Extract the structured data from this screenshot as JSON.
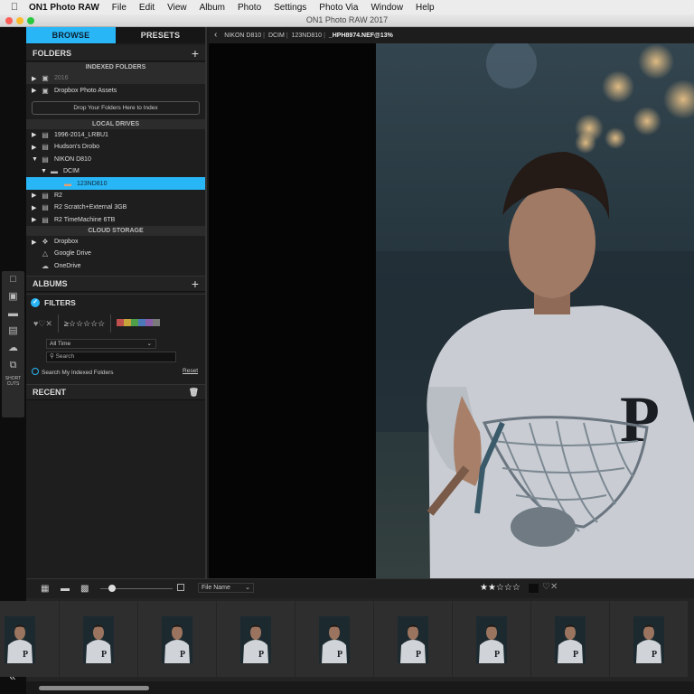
{
  "menubar": {
    "app": "ON1 Photo RAW",
    "items": [
      "File",
      "Edit",
      "View",
      "Album",
      "Photo",
      "Settings",
      "Photo Via",
      "Window",
      "Help"
    ]
  },
  "window": {
    "title": "ON1 Photo RAW 2017"
  },
  "colors": {
    "accent": "#29b6f6",
    "close": "#fc5f57",
    "minimize": "#fdbc2e",
    "zoom": "#29c840"
  },
  "tabs": {
    "browse": "BROWSE",
    "presets": "PRESETS"
  },
  "folders": {
    "title": "FOLDERS",
    "indexed_header": "INDEXED FOLDERS",
    "indexed": [
      {
        "label": "2016"
      },
      {
        "label": "Dropbox Photo Assets"
      }
    ],
    "drop_label": "Drop Your Folders Here to Index",
    "local_header": "LOCAL DRIVES",
    "local": [
      {
        "label": "1996-2014_LRBU1"
      },
      {
        "label": "Hudson's Drobo"
      },
      {
        "label": "NIKON D810"
      },
      {
        "label": "DCIM"
      },
      {
        "label": "123ND810"
      },
      {
        "label": "R2"
      },
      {
        "label": "R2 Scratch+External 3GB"
      },
      {
        "label": "R2 TimeMachine 6TB"
      }
    ],
    "cloud_header": "CLOUD STORAGE",
    "cloud": [
      {
        "label": "Dropbox"
      },
      {
        "label": "Google Drive"
      },
      {
        "label": "OneDrive"
      }
    ]
  },
  "albums": {
    "title": "ALBUMS"
  },
  "filters": {
    "title": "FILTERS",
    "date_select": "All Time",
    "search_placeholder": "Search",
    "index_label": "Search My Indexed Folders",
    "reset_label": "Reset",
    "color_labels": [
      "#c0504d",
      "#c7a33b",
      "#4f9e4a",
      "#4a78b8",
      "#8a5da8",
      "#7a7a7a"
    ]
  },
  "recent": {
    "title": "RECENT"
  },
  "breadcrumb": {
    "parts": [
      "NIKON D810",
      "DCIM",
      "123ND810"
    ],
    "file": "_HPH8974.NEF@13%"
  },
  "filmbar": {
    "sort": "File Name",
    "rating_stars": 2
  },
  "filmstrip": {
    "count": 9
  }
}
